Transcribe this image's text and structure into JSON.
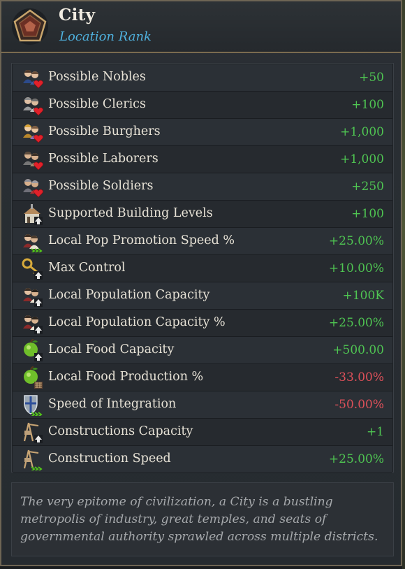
{
  "header": {
    "title": "City",
    "subtitle": "Location Rank",
    "emblem_icon": "pentagon-rank-icon"
  },
  "colors": {
    "positive": "#4fc552",
    "negative": "#e0515a",
    "subtitle": "#4fb1de",
    "border": "#7a6b4f"
  },
  "modifiers": [
    {
      "icon": "nobles-pop-icon",
      "label": "Possible Nobles",
      "value": "+50",
      "sign": "pos"
    },
    {
      "icon": "clerics-pop-icon",
      "label": "Possible Clerics",
      "value": "+100",
      "sign": "pos"
    },
    {
      "icon": "burghers-pop-icon",
      "label": "Possible Burghers",
      "value": "+1,000",
      "sign": "pos"
    },
    {
      "icon": "laborers-pop-icon",
      "label": "Possible Laborers",
      "value": "+1,000",
      "sign": "pos"
    },
    {
      "icon": "soldiers-pop-icon",
      "label": "Possible Soldiers",
      "value": "+250",
      "sign": "pos"
    },
    {
      "icon": "building-levels-icon",
      "label": "Supported Building Levels",
      "value": "+100",
      "sign": "pos"
    },
    {
      "icon": "pop-promotion-icon",
      "label": "Local Pop Promotion Speed %",
      "value": "+25.00%",
      "sign": "pos"
    },
    {
      "icon": "control-key-icon",
      "label": "Max Control",
      "value": "+10.00%",
      "sign": "pos"
    },
    {
      "icon": "population-capacity-icon",
      "label": "Local Population Capacity",
      "value": "+100K",
      "sign": "pos"
    },
    {
      "icon": "population-capacity-percent-icon",
      "label": "Local Population Capacity %",
      "value": "+25.00%",
      "sign": "pos"
    },
    {
      "icon": "food-capacity-icon",
      "label": "Local Food Capacity",
      "value": "+500.00",
      "sign": "pos"
    },
    {
      "icon": "food-production-icon",
      "label": "Local Food Production %",
      "value": "-33.00%",
      "sign": "neg"
    },
    {
      "icon": "integration-shield-icon",
      "label": "Speed of Integration",
      "value": "-50.00%",
      "sign": "neg"
    },
    {
      "icon": "construction-capacity-icon",
      "label": "Constructions Capacity",
      "value": "+1",
      "sign": "pos"
    },
    {
      "icon": "construction-speed-icon",
      "label": "Construction Speed",
      "value": "+25.00%",
      "sign": "pos"
    }
  ],
  "description": "The very epitome of civilization, a City is a bustling metropolis of industry, great temples, and seats of governmental authority sprawled across multiple districts."
}
